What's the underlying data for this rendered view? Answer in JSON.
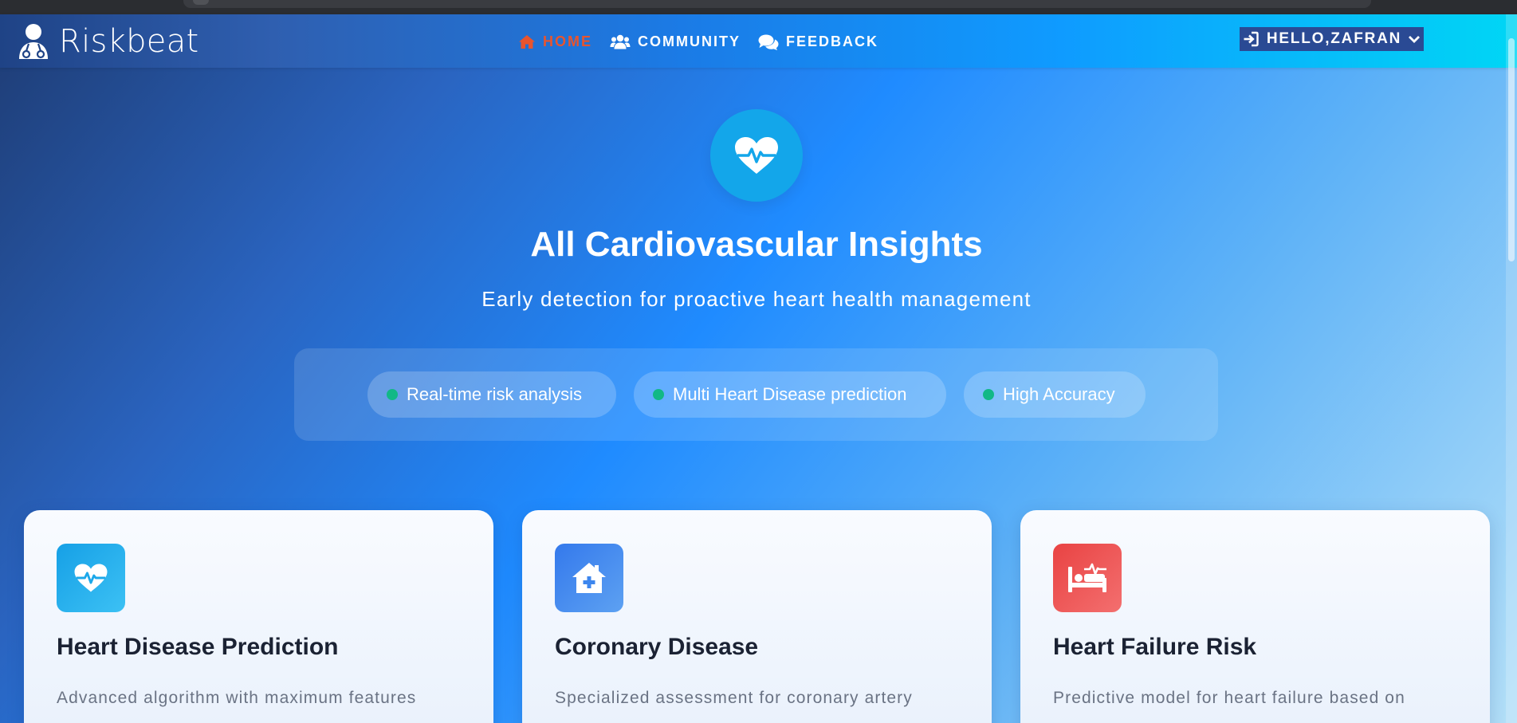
{
  "brand": {
    "name": "Riskbeat"
  },
  "nav": {
    "items": [
      {
        "label": "HOME",
        "icon": "home-icon",
        "active": true
      },
      {
        "label": "COMMUNITY",
        "icon": "users-icon",
        "active": false
      },
      {
        "label": "FEEDBACK",
        "icon": "comments-icon",
        "active": false
      }
    ],
    "user_label": "HELLO,ZAFRAN"
  },
  "hero": {
    "title": "All Cardiovascular Insights",
    "subtitle": "Early detection for proactive heart health management",
    "features": [
      "Real-time risk analysis",
      "Multi Heart Disease prediction",
      "High Accuracy"
    ]
  },
  "cards": [
    {
      "title": "Heart Disease Prediction",
      "description": "Advanced algorithm with maximum features",
      "icon": "heart-pulse-icon"
    },
    {
      "title": "Coronary Disease",
      "description": "Specialized assessment for coronary artery",
      "icon": "house-medical-icon"
    },
    {
      "title": "Heart Failure Risk",
      "description": "Predictive model for heart failure based on",
      "icon": "hospital-bed-icon"
    }
  ],
  "colors": {
    "nav_active": "#e8542e",
    "feature_dot": "#12b886",
    "hero_icon_bg": "#13a6ea",
    "card1_icon_bg": "#1ca8ea",
    "card2_icon_bg": "#3d86ee",
    "card3_icon_bg": "#ed4e4e"
  }
}
